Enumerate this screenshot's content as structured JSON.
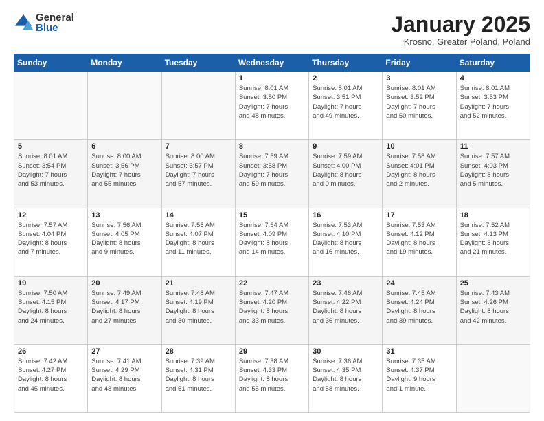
{
  "logo": {
    "general": "General",
    "blue": "Blue"
  },
  "header": {
    "title": "January 2025",
    "location": "Krosno, Greater Poland, Poland"
  },
  "days_of_week": [
    "Sunday",
    "Monday",
    "Tuesday",
    "Wednesday",
    "Thursday",
    "Friday",
    "Saturday"
  ],
  "weeks": [
    [
      {
        "day": "",
        "info": ""
      },
      {
        "day": "",
        "info": ""
      },
      {
        "day": "",
        "info": ""
      },
      {
        "day": "1",
        "info": "Sunrise: 8:01 AM\nSunset: 3:50 PM\nDaylight: 7 hours\nand 48 minutes."
      },
      {
        "day": "2",
        "info": "Sunrise: 8:01 AM\nSunset: 3:51 PM\nDaylight: 7 hours\nand 49 minutes."
      },
      {
        "day": "3",
        "info": "Sunrise: 8:01 AM\nSunset: 3:52 PM\nDaylight: 7 hours\nand 50 minutes."
      },
      {
        "day": "4",
        "info": "Sunrise: 8:01 AM\nSunset: 3:53 PM\nDaylight: 7 hours\nand 52 minutes."
      }
    ],
    [
      {
        "day": "5",
        "info": "Sunrise: 8:01 AM\nSunset: 3:54 PM\nDaylight: 7 hours\nand 53 minutes."
      },
      {
        "day": "6",
        "info": "Sunrise: 8:00 AM\nSunset: 3:56 PM\nDaylight: 7 hours\nand 55 minutes."
      },
      {
        "day": "7",
        "info": "Sunrise: 8:00 AM\nSunset: 3:57 PM\nDaylight: 7 hours\nand 57 minutes."
      },
      {
        "day": "8",
        "info": "Sunrise: 7:59 AM\nSunset: 3:58 PM\nDaylight: 7 hours\nand 59 minutes."
      },
      {
        "day": "9",
        "info": "Sunrise: 7:59 AM\nSunset: 4:00 PM\nDaylight: 8 hours\nand 0 minutes."
      },
      {
        "day": "10",
        "info": "Sunrise: 7:58 AM\nSunset: 4:01 PM\nDaylight: 8 hours\nand 2 minutes."
      },
      {
        "day": "11",
        "info": "Sunrise: 7:57 AM\nSunset: 4:03 PM\nDaylight: 8 hours\nand 5 minutes."
      }
    ],
    [
      {
        "day": "12",
        "info": "Sunrise: 7:57 AM\nSunset: 4:04 PM\nDaylight: 8 hours\nand 7 minutes."
      },
      {
        "day": "13",
        "info": "Sunrise: 7:56 AM\nSunset: 4:05 PM\nDaylight: 8 hours\nand 9 minutes."
      },
      {
        "day": "14",
        "info": "Sunrise: 7:55 AM\nSunset: 4:07 PM\nDaylight: 8 hours\nand 11 minutes."
      },
      {
        "day": "15",
        "info": "Sunrise: 7:54 AM\nSunset: 4:09 PM\nDaylight: 8 hours\nand 14 minutes."
      },
      {
        "day": "16",
        "info": "Sunrise: 7:53 AM\nSunset: 4:10 PM\nDaylight: 8 hours\nand 16 minutes."
      },
      {
        "day": "17",
        "info": "Sunrise: 7:53 AM\nSunset: 4:12 PM\nDaylight: 8 hours\nand 19 minutes."
      },
      {
        "day": "18",
        "info": "Sunrise: 7:52 AM\nSunset: 4:13 PM\nDaylight: 8 hours\nand 21 minutes."
      }
    ],
    [
      {
        "day": "19",
        "info": "Sunrise: 7:50 AM\nSunset: 4:15 PM\nDaylight: 8 hours\nand 24 minutes."
      },
      {
        "day": "20",
        "info": "Sunrise: 7:49 AM\nSunset: 4:17 PM\nDaylight: 8 hours\nand 27 minutes."
      },
      {
        "day": "21",
        "info": "Sunrise: 7:48 AM\nSunset: 4:19 PM\nDaylight: 8 hours\nand 30 minutes."
      },
      {
        "day": "22",
        "info": "Sunrise: 7:47 AM\nSunset: 4:20 PM\nDaylight: 8 hours\nand 33 minutes."
      },
      {
        "day": "23",
        "info": "Sunrise: 7:46 AM\nSunset: 4:22 PM\nDaylight: 8 hours\nand 36 minutes."
      },
      {
        "day": "24",
        "info": "Sunrise: 7:45 AM\nSunset: 4:24 PM\nDaylight: 8 hours\nand 39 minutes."
      },
      {
        "day": "25",
        "info": "Sunrise: 7:43 AM\nSunset: 4:26 PM\nDaylight: 8 hours\nand 42 minutes."
      }
    ],
    [
      {
        "day": "26",
        "info": "Sunrise: 7:42 AM\nSunset: 4:27 PM\nDaylight: 8 hours\nand 45 minutes."
      },
      {
        "day": "27",
        "info": "Sunrise: 7:41 AM\nSunset: 4:29 PM\nDaylight: 8 hours\nand 48 minutes."
      },
      {
        "day": "28",
        "info": "Sunrise: 7:39 AM\nSunset: 4:31 PM\nDaylight: 8 hours\nand 51 minutes."
      },
      {
        "day": "29",
        "info": "Sunrise: 7:38 AM\nSunset: 4:33 PM\nDaylight: 8 hours\nand 55 minutes."
      },
      {
        "day": "30",
        "info": "Sunrise: 7:36 AM\nSunset: 4:35 PM\nDaylight: 8 hours\nand 58 minutes."
      },
      {
        "day": "31",
        "info": "Sunrise: 7:35 AM\nSunset: 4:37 PM\nDaylight: 9 hours\nand 1 minute."
      },
      {
        "day": "",
        "info": ""
      }
    ]
  ]
}
